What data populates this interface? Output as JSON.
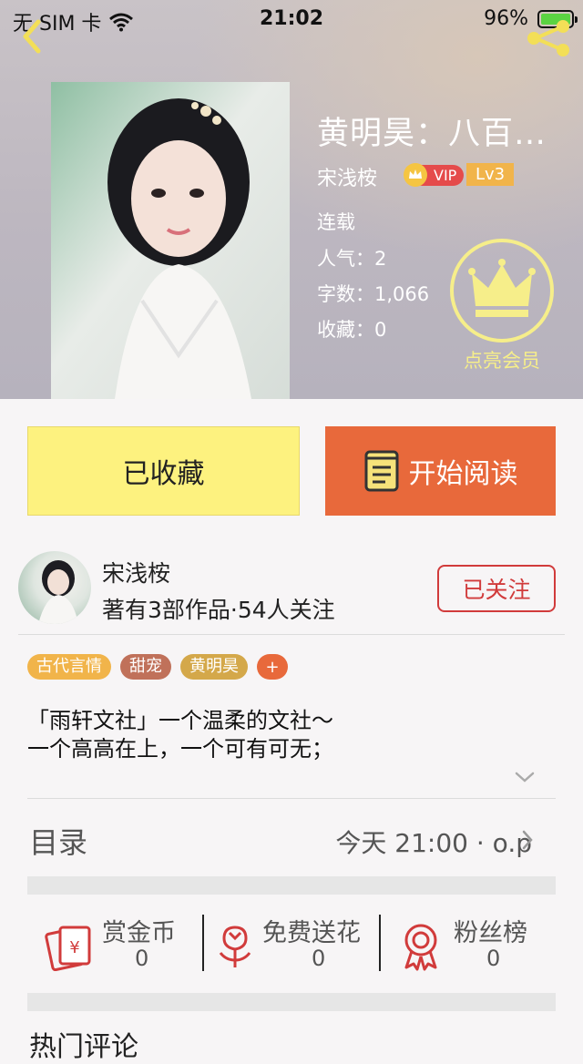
{
  "status_bar": {
    "carrier": "无 SIM 卡",
    "time": "21:02",
    "battery": "96%"
  },
  "icons": {
    "back": "back-chevron-icon",
    "share": "share-icon",
    "crown": "crown-icon",
    "book": "book-icon",
    "reward": "red-envelope-icon",
    "flower": "flower-icon",
    "fans": "medal-icon"
  },
  "colors": {
    "accent_orange": "#e8693b",
    "fav_yellow": "#fdf27f",
    "follow_red": "#d13b3b",
    "crown_yellow": "#f6ee8a"
  },
  "book": {
    "title": "黄明昊：八百年的温柔",
    "author": "宋浅桉",
    "vip_label": "VIP",
    "level": "Lv3",
    "status": "连载",
    "popularity": "人气：2",
    "word_count": "字数：1,066",
    "favorites": "收藏：0",
    "member_label": "点亮会员"
  },
  "buttons": {
    "favorited": "已收藏",
    "start_reading": "开始阅读"
  },
  "author_info": {
    "name": "宋浅桉",
    "stats": "著有3部作品·54人关注",
    "follow_label": "已关注"
  },
  "tags": [
    {
      "label": "古代言情",
      "color": "#f1b44a"
    },
    {
      "label": "甜宠",
      "color": "#c0715a"
    },
    {
      "label": "黄明昊",
      "color": "#d4a84a"
    }
  ],
  "tag_add": "+",
  "description": {
    "line1": "「雨轩文社」一个温柔的文社～",
    "line2": "一个高高在上，一个可有可无；"
  },
  "toc": {
    "label": "目录",
    "latest": "今天 21:00 · o.p"
  },
  "actions": [
    {
      "title": "赏金币",
      "count": "0"
    },
    {
      "title": "免费送花",
      "count": "0"
    },
    {
      "title": "粉丝榜",
      "count": "0"
    }
  ],
  "comments_label": "热门评论"
}
